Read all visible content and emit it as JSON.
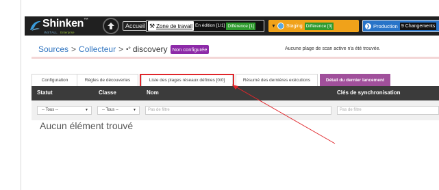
{
  "topbar": {
    "logo_text": "Shinken",
    "logo_tm": "™",
    "logo_sub_left": "INSTALL",
    "logo_sub_right": "Enterprise",
    "home_icon": "arrow-up-icon",
    "accueil_label": "Accueil",
    "work_zone": {
      "icon": "tools-icon",
      "label": "Zone de travail",
      "edit_status": "En édition [1/1]",
      "diff": "Différence [1]"
    },
    "staging": {
      "caret": "▼",
      "label": "Staging",
      "diff": "Différence [3]",
      "color": "#f0a21a"
    },
    "production": {
      "icon_glyph": "❯",
      "label": "Production",
      "changes": "9 Changements",
      "color": "#2874c8"
    }
  },
  "breadcrumb": {
    "sources": "Sources",
    "sep1": ">",
    "collecteur": "Collecteur",
    "sep2": ">",
    "discovery_icon": "•°",
    "discovery": "discovery",
    "badge": "Non configurée",
    "message": "Aucune plage de scan active n'a été trouvée."
  },
  "tabs": [
    {
      "label": "Configuration",
      "active": false
    },
    {
      "label": "Règles de découvertes",
      "active": false
    },
    {
      "label": "Liste des plages réseaux définies [0/0]",
      "active": false
    },
    {
      "label": "Résumé des dernières exécutions",
      "active": false
    },
    {
      "label": "Détail du dernier lancement",
      "active": true
    }
  ],
  "table": {
    "headers": [
      "Statut",
      "Classe",
      "Nom",
      "Clés de synchronisation"
    ],
    "filters": {
      "statut": "-- Tous --",
      "classe": "-- Tous --",
      "nom_placeholder": "Pas de filtre",
      "cles_placeholder": "Pas de filtre"
    },
    "empty_message": "Aucun élément trouvé"
  },
  "colors": {
    "active_tab": "#a0509b",
    "badge": "#8d2aa8",
    "highlight": "#e0262b",
    "header_bg": "#3b3b3b"
  }
}
